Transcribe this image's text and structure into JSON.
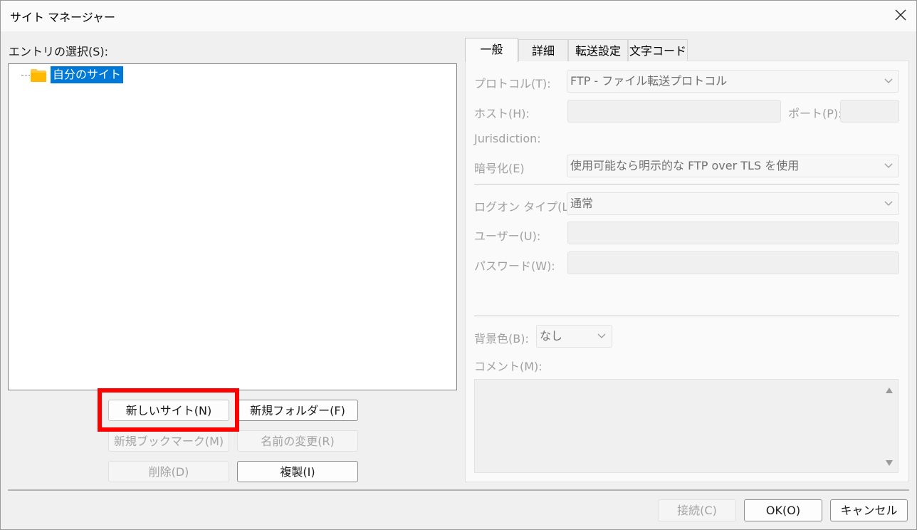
{
  "window": {
    "title": "サイト マネージャー"
  },
  "left": {
    "label": "エントリの選択(S):",
    "tree": [
      {
        "label": "自分のサイト",
        "icon": "folder-icon",
        "selected": true
      }
    ],
    "buttons": {
      "new_site": "新しいサイト(N)",
      "new_folder": "新規フォルダー(F)",
      "new_bookmark": "新規ブックマーク(M)",
      "rename": "名前の変更(R)",
      "delete": "削除(D)",
      "duplicate": "複製(I)"
    }
  },
  "tabs": [
    "一般",
    "詳細",
    "転送設定",
    "文字コード"
  ],
  "general": {
    "protocol_label": "プロトコル(T):",
    "protocol_value": "FTP - ファイル転送プロトコル",
    "host_label": "ホスト(H):",
    "port_label": "ポート(P):",
    "jurisdiction_label": "Jurisdiction:",
    "encryption_label": "暗号化(E)",
    "encryption_value": "使用可能なら明示的な FTP over TLS を使用",
    "logon_label": "ログオン タイプ(L):",
    "logon_value": "通常",
    "user_label": "ユーザー(U):",
    "password_label": "パスワード(W):",
    "bgcolor_label": "背景色(B):",
    "bgcolor_value": "なし",
    "comment_label": "コメント(M):"
  },
  "footer": {
    "connect": "接続(C)",
    "ok": "OK(O)",
    "cancel": "キャンセル"
  },
  "colors": {
    "selection": "#0078d7",
    "highlight": "#ff0000",
    "folder": "#ffc83d"
  }
}
